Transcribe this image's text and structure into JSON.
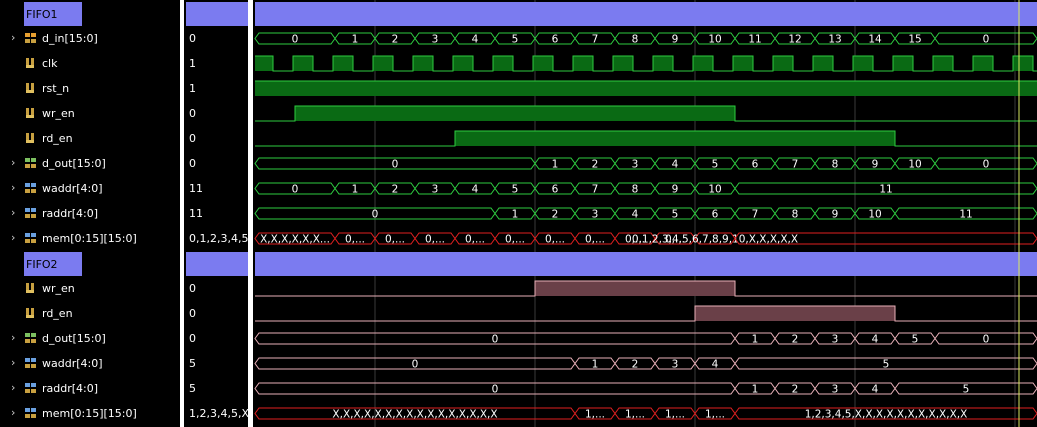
{
  "groups": [
    {
      "label": "FIFO1"
    },
    {
      "label": "FIFO2"
    }
  ],
  "rows": [
    {
      "kind": "group",
      "label": "FIFO1"
    },
    {
      "kind": "bus",
      "name": "d_in[15:0]",
      "value": "0",
      "icon": "bus-input-icon"
    },
    {
      "kind": "bit",
      "name": "clk",
      "value": "1",
      "icon": "bit-signal-icon"
    },
    {
      "kind": "bit",
      "name": "rst_n",
      "value": "1",
      "icon": "bit-signal-icon"
    },
    {
      "kind": "bit",
      "name": "wr_en",
      "value": "0",
      "icon": "bit-signal-icon"
    },
    {
      "kind": "bit",
      "name": "rd_en",
      "value": "0",
      "icon": "bit-signal-icon"
    },
    {
      "kind": "bus",
      "name": "d_out[15:0]",
      "value": "0",
      "icon": "bus-output-icon"
    },
    {
      "kind": "bus",
      "name": "waddr[4:0]",
      "value": "11",
      "icon": "bus-internal-icon"
    },
    {
      "kind": "bus",
      "name": "raddr[4:0]",
      "value": "11",
      "icon": "bus-internal-icon"
    },
    {
      "kind": "bus",
      "name": "mem[0:15][15:0]",
      "value": "0,1,2,3,4,5,",
      "icon": "bus-internal-icon"
    },
    {
      "kind": "group",
      "label": "FIFO2"
    },
    {
      "kind": "bit",
      "name": "wr_en",
      "value": "0",
      "icon": "bit-signal-icon"
    },
    {
      "kind": "bit",
      "name": "rd_en",
      "value": "0",
      "icon": "bit-signal-icon"
    },
    {
      "kind": "bus",
      "name": "d_out[15:0]",
      "value": "0",
      "icon": "bus-output-icon"
    },
    {
      "kind": "bus",
      "name": "waddr[4:0]",
      "value": "5",
      "icon": "bus-internal-icon"
    },
    {
      "kind": "bus",
      "name": "raddr[4:0]",
      "value": "5",
      "icon": "bus-internal-icon"
    },
    {
      "kind": "bus",
      "name": "mem[0:15][15:0]",
      "value": "1,2,3,4,5,X,",
      "icon": "bus-internal-icon"
    }
  ],
  "colors": {
    "fifo1_wave": "#2ecc40",
    "fifo1_fill": "#0a6a14",
    "fifo2_wave": "#e8b0b8",
    "fifo2_fill": "#6a4048",
    "x_state": "#e02020",
    "group_bar": "#7b7bf0",
    "grid": "#3a3a3a",
    "cursor": "#d8e860"
  },
  "waves": {
    "fifo1_d_in": [
      "0",
      "1",
      "2",
      "3",
      "4",
      "5",
      "6",
      "7",
      "8",
      "9",
      "10",
      "11",
      "12",
      "13",
      "14",
      "15",
      "0"
    ],
    "fifo1_d_out": [
      "0",
      "1",
      "2",
      "3",
      "4",
      "5",
      "6",
      "7",
      "8",
      "9",
      "10",
      "0"
    ],
    "fifo1_waddr": [
      "0",
      "1",
      "2",
      "3",
      "4",
      "5",
      "6",
      "7",
      "8",
      "9",
      "10",
      "11"
    ],
    "fifo1_raddr": [
      "0",
      "1",
      "2",
      "3",
      "4",
      "5",
      "6",
      "7",
      "8",
      "9",
      "10",
      "11"
    ],
    "fifo1_mem": [
      "X,X,X,X,X,X...",
      "0,...",
      "0,...",
      "0,...",
      "0,...",
      "0,...",
      "0,...",
      "0,...",
      "0,...",
      "0,...",
      "0,1,2,3,4,5,6,7,8,9,10,X,X,X,X,X"
    ],
    "fifo2_d_out": [
      "0",
      "1",
      "2",
      "3",
      "4",
      "5",
      "0"
    ],
    "fifo2_waddr": [
      "0",
      "1",
      "2",
      "3",
      "4",
      "5"
    ],
    "fifo2_raddr": [
      "0",
      "1",
      "2",
      "3",
      "4",
      "5"
    ],
    "fifo2_mem": [
      "X,X,X,X,X,X,X,X,X,X,X,X,X,X,X,X",
      "1,...",
      "1,...",
      "1,...",
      "1,...",
      "1,2,3,4,5,X,X,X,X,X,X,X,X,X,X,X"
    ]
  }
}
